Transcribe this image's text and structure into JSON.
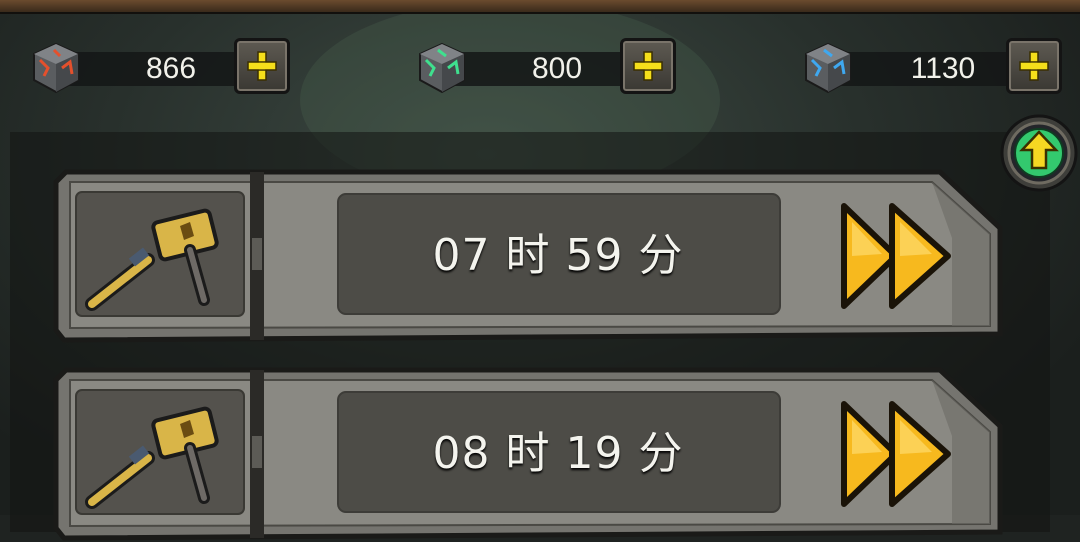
{
  "resources": [
    {
      "icon": "red-ore-cube-icon",
      "value": "866",
      "accent": "#e4502c"
    },
    {
      "icon": "green-ore-cube-icon",
      "value": "800",
      "accent": "#3fe08e"
    },
    {
      "icon": "blue-ore-cube-icon",
      "value": "1130",
      "accent": "#3fa8f0"
    }
  ],
  "colors": {
    "plus": "#f5df1b",
    "speedup": "#f7b91e",
    "upgrade": "#33c96e",
    "hammer_gold": "#d9b548"
  },
  "queue": [
    {
      "timer": "07 时 59 分",
      "item_icon": "hammer-icon",
      "action_icon": "fast-forward-icon"
    },
    {
      "timer": "08 时 19 分",
      "item_icon": "hammer-icon",
      "action_icon": "fast-forward-icon"
    }
  ],
  "upgrade_button": {
    "icon": "upgrade-arrow-icon"
  }
}
